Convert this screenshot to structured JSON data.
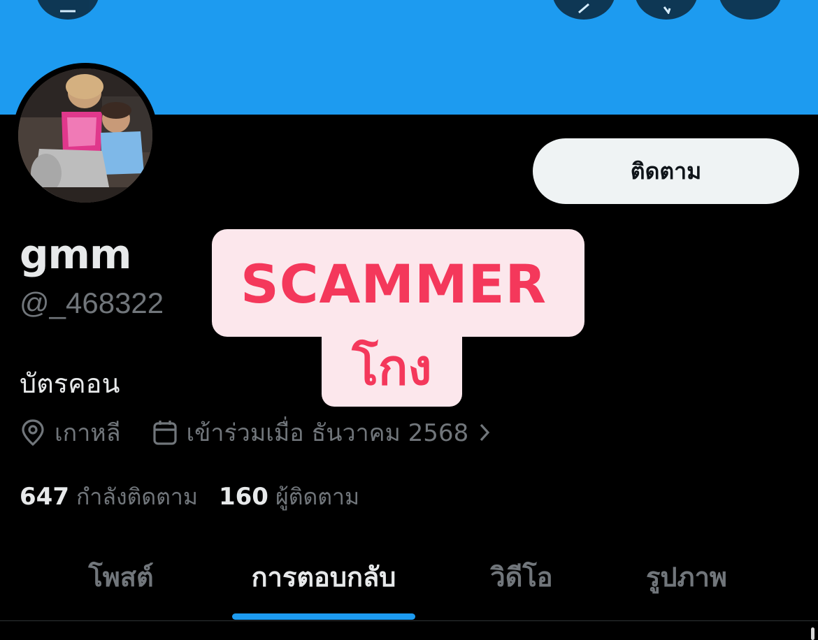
{
  "header": {
    "buttons": [
      {
        "icon": "back-icon"
      },
      {
        "icon": "share-icon"
      },
      {
        "icon": "search-icon"
      },
      {
        "icon": "more-icon"
      }
    ],
    "banner_color": "#1d9bf0"
  },
  "profile": {
    "follow_label": "ติดตาม",
    "name": "gmm",
    "handle": "@_468322",
    "bio": "บัตรคอน",
    "location": "เกาหลี",
    "joined": "เข้าร่วมเมื่อ ธันวาคม 2568",
    "following_count": "647",
    "following_label": "กำลังติดตาม",
    "followers_count": "160",
    "followers_label": "ผู้ติดตาม"
  },
  "tabs": [
    {
      "label": "โพสต์",
      "active": false
    },
    {
      "label": "การตอบกลับ",
      "active": true
    },
    {
      "label": "วิดีโอ",
      "active": false
    },
    {
      "label": "รูปภาพ",
      "active": false
    }
  ],
  "overlay": {
    "line1": "SCAMMER",
    "line2": "โกง",
    "text_color": "#f4385b",
    "background": "#fce7ec"
  },
  "colors": {
    "accent": "#1d9bf0",
    "background": "#000000",
    "text_primary": "#e7e9ea",
    "text_secondary": "#71767b"
  }
}
